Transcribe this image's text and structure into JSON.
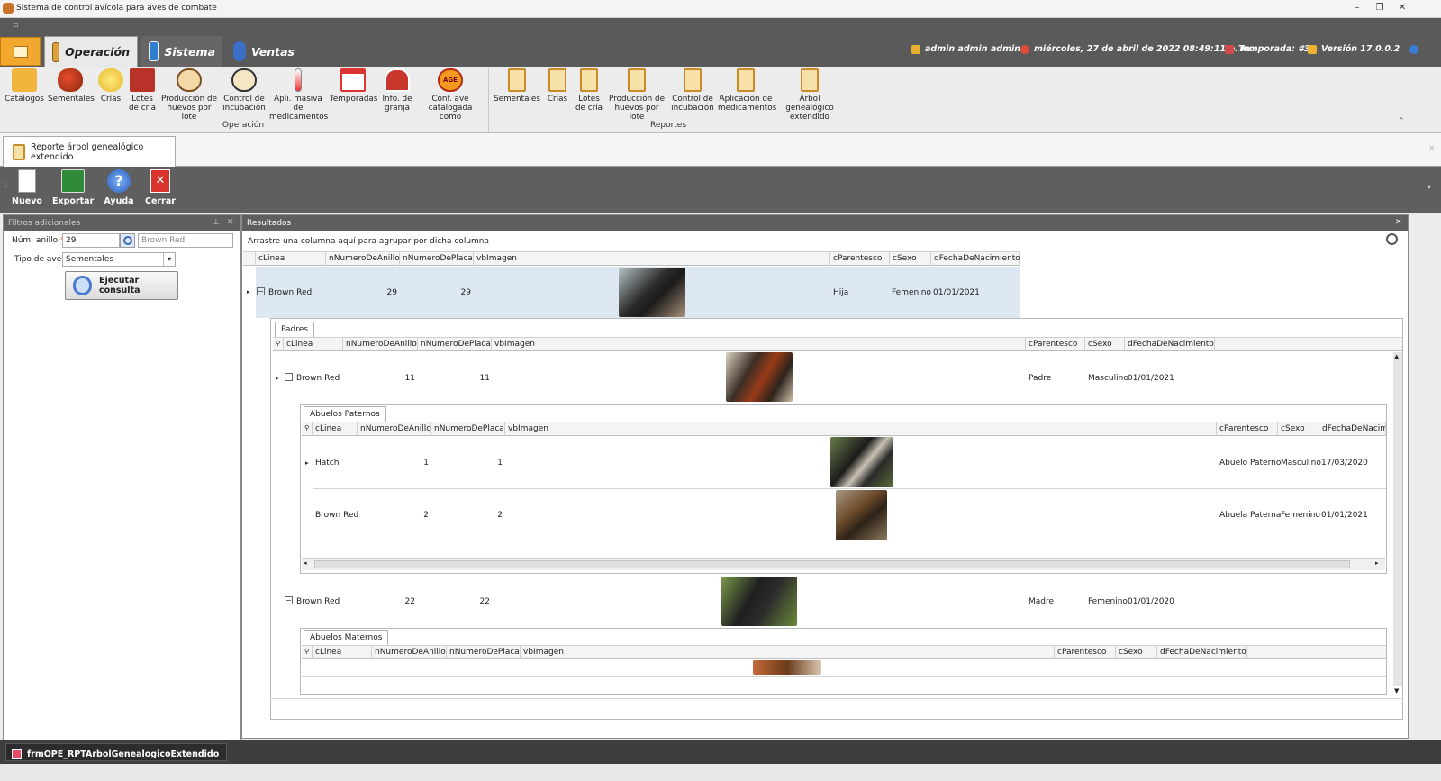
{
  "window": {
    "title": "Sistema de control avícola para aves de combate"
  },
  "ribbon_tabs": [
    {
      "label": "Operación",
      "icon": "box-icon",
      "active": true
    },
    {
      "label": "Sistema",
      "icon": "window-icon",
      "active": false
    },
    {
      "label": "Ventas",
      "icon": "sales-icon",
      "active": false
    }
  ],
  "status": {
    "user": "admin admin admin",
    "datetime": "miércoles, 27 de abril de 2022 08:49:11 p. m.",
    "season": "Temporada: #3",
    "version": "Versión 17.0.0.2"
  },
  "ribbon_groups": {
    "operacion": {
      "label": "Operación",
      "buttons": [
        {
          "label": "Catálogos",
          "icon": "folder-icon"
        },
        {
          "label": "Sementales",
          "icon": "rooster-icon"
        },
        {
          "label": "Crías",
          "icon": "chick-icon"
        },
        {
          "label": "Lotes de cría",
          "icon": "barn-icon"
        },
        {
          "label": "Producción de huevos por lote",
          "icon": "eggs-icon"
        },
        {
          "label": "Control de incubación",
          "icon": "incubator-icon"
        },
        {
          "label": "Apli. masiva de medicamentos",
          "icon": "thermometer-icon"
        },
        {
          "label": "Temporadas",
          "icon": "calendar-icon"
        },
        {
          "label": "Info. de granja",
          "icon": "farm-icon"
        },
        {
          "label": "Conf. ave catalogada como",
          "icon": "age-icon"
        }
      ]
    },
    "reportes": {
      "label": "Reportes",
      "buttons": [
        {
          "label": "Sementales",
          "icon": "clipboard-icon"
        },
        {
          "label": "Crías",
          "icon": "clipboard-icon"
        },
        {
          "label": "Lotes de cría",
          "icon": "clipboard-icon"
        },
        {
          "label": "Producción de huevos por lote",
          "icon": "clipboard-icon"
        },
        {
          "label": "Control de incubación",
          "icon": "clipboard-icon"
        },
        {
          "label": "Aplicación de medicamentos",
          "icon": "clipboard-icon"
        },
        {
          "label": "Árbol genealógico extendido",
          "icon": "clipboard-icon"
        }
      ]
    }
  },
  "doc_tab": {
    "label": "Reporte árbol genealógico extendido"
  },
  "toolbar": {
    "nuevo": "Nuevo",
    "exportar": "Exportar",
    "ayuda": "Ayuda",
    "cerrar": "Cerrar"
  },
  "filters": {
    "title": "Filtros adicionales",
    "ring_label": "Núm. anillo:",
    "ring_required_mark": "*",
    "ring_value": "29",
    "line_value": "Brown Red",
    "bird_type_label": "Tipo de ave:",
    "bird_type_value": "Sementales",
    "execute": "Ejecutar consulta"
  },
  "results": {
    "title": "Resultados",
    "group_hint": "Arrastre una columna aquí para agrupar por dicha columna",
    "columns": [
      "cLinea",
      "nNumeroDeAnillo",
      "nNumeroDePlaca",
      "vbImagen",
      "cParentesco",
      "cSexo",
      "dFechaDeNacimiento"
    ],
    "main_row": {
      "linea": "Brown Red",
      "anillo": "29",
      "placa": "29",
      "parentesco": "Hija",
      "sexo": "Femenino",
      "fecha": "01/01/2021"
    },
    "padres": {
      "tab": "Padres",
      "rows": [
        {
          "linea": "Brown Red",
          "anillo": "11",
          "placa": "11",
          "parentesco": "Padre",
          "sexo": "Masculino",
          "fecha": "01/01/2021"
        },
        {
          "linea": "Brown Red",
          "anillo": "22",
          "placa": "22",
          "parentesco": "Madre",
          "sexo": "Femenino",
          "fecha": "01/01/2020"
        }
      ]
    },
    "abuelos_paternos": {
      "tab": "Abuelos Paternos",
      "last_col": "dFechaDeNacimien",
      "rows": [
        {
          "linea": "Hatch",
          "anillo": "1",
          "placa": "1",
          "parentesco": "Abuelo Paterno",
          "sexo": "Masculino",
          "fecha": "17/03/2020"
        },
        {
          "linea": "Brown Red",
          "anillo": "2",
          "placa": "2",
          "parentesco": "Abuela Paterna",
          "sexo": "Femenino",
          "fecha": "01/01/2021"
        }
      ]
    },
    "abuelos_maternos": {
      "tab": "Abuelos Maternos"
    }
  },
  "taskbar": {
    "item": "frmOPE_RPTArbolGenealogicoExtendido"
  },
  "colors": {
    "accent": "#f2a82e",
    "dark": "#5a5a5a",
    "selected_row": "#dde8f3",
    "close_red": "#d9332b"
  }
}
